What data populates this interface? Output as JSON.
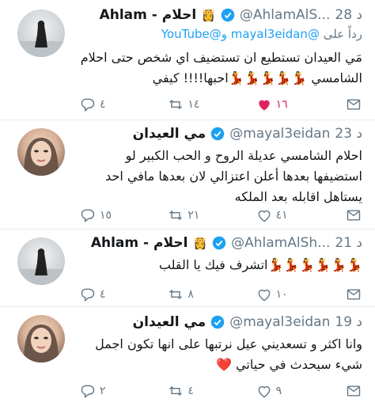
{
  "tweets": [
    {
      "author_name": "Ahlam - احلام",
      "crown": "👸",
      "handle": "@AhlamAlS...",
      "time": "28 د",
      "replying_prefix": "رداً على",
      "replying_mentions": "@mayal3eidan و@YouTube",
      "text": "مَي العيدان تستطيع ان تستضيف اي شخص حتى احلام الشامسي 💃💃💃💃💃احبها!!!! كيفي",
      "replies": "٤",
      "retweets": "١٤",
      "likes": "١٦",
      "liked": true
    },
    {
      "author_name": "مي العيدان",
      "handle": "@mayal3eidan",
      "time": "23 د",
      "text": "احلام الشامسي عديلة الروح و الحب الكبير  لو استضيفها بعدها أعلن اعتزالي لان بعدها مافي احد يستاهل اقابله بعد الملكه",
      "replies": "١٥",
      "retweets": "٢١",
      "likes": "٤١"
    },
    {
      "author_name": "Ahlam - احلام",
      "crown": "👸",
      "handle": "@AhlamAlSh...",
      "time": "21 د",
      "text": "💃💃💃💃💃💃اتشرف فيك يا القلب",
      "replies": "٤",
      "retweets": "٨",
      "likes": "١٠"
    },
    {
      "author_name": "مي العيدان",
      "handle": "@mayal3eidan",
      "time": "19 د",
      "text": "وانا اكثر و تسعديني عيل نرتبها على انها تكون اجمل شيء سيحدث في حياتي ❤️",
      "replies": "٢",
      "retweets": "٤",
      "likes": "٩"
    }
  ],
  "colors": {
    "verified": "#1da1f2",
    "like_active": "#e0245e",
    "muted": "#657786",
    "separator": "#e6ecf0"
  },
  "icons": [
    "reply-icon",
    "retweet-icon",
    "like-icon",
    "share-icon",
    "verified-icon"
  ]
}
